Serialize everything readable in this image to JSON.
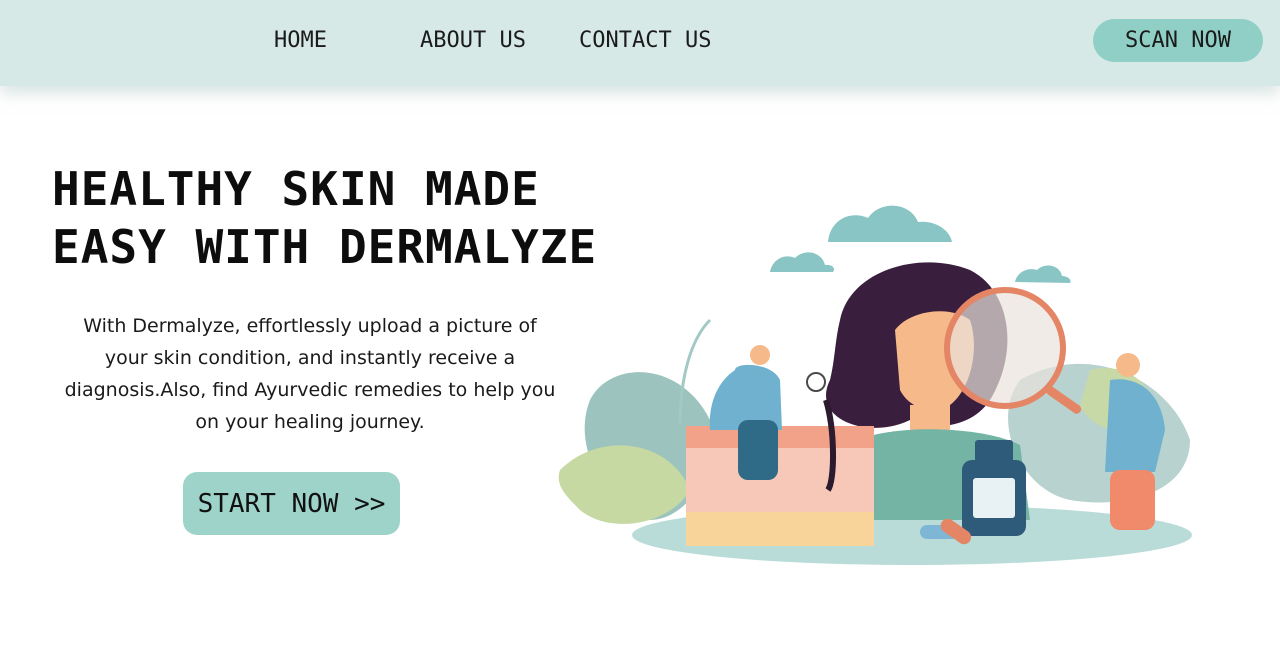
{
  "nav": {
    "links": [
      {
        "label": "HOME"
      },
      {
        "label": "ABOUT US"
      },
      {
        "label": "CONTACT US"
      }
    ],
    "cta_label": "SCAN NOW"
  },
  "hero": {
    "title_line1": "HEALTHY SKIN MADE",
    "title_line2": "EASY WITH DERMALYZE",
    "description": "With Dermalyze, effortlessly upload a picture of your skin condition, and instantly receive a diagnosis.Also, find Ayurvedic remedies to help you on your healing journey.",
    "cta_label": "START NOW >>"
  },
  "colors": {
    "navbar_bg": "#d6e9e6",
    "accent": "#8fcfc5",
    "text": "#111111"
  }
}
